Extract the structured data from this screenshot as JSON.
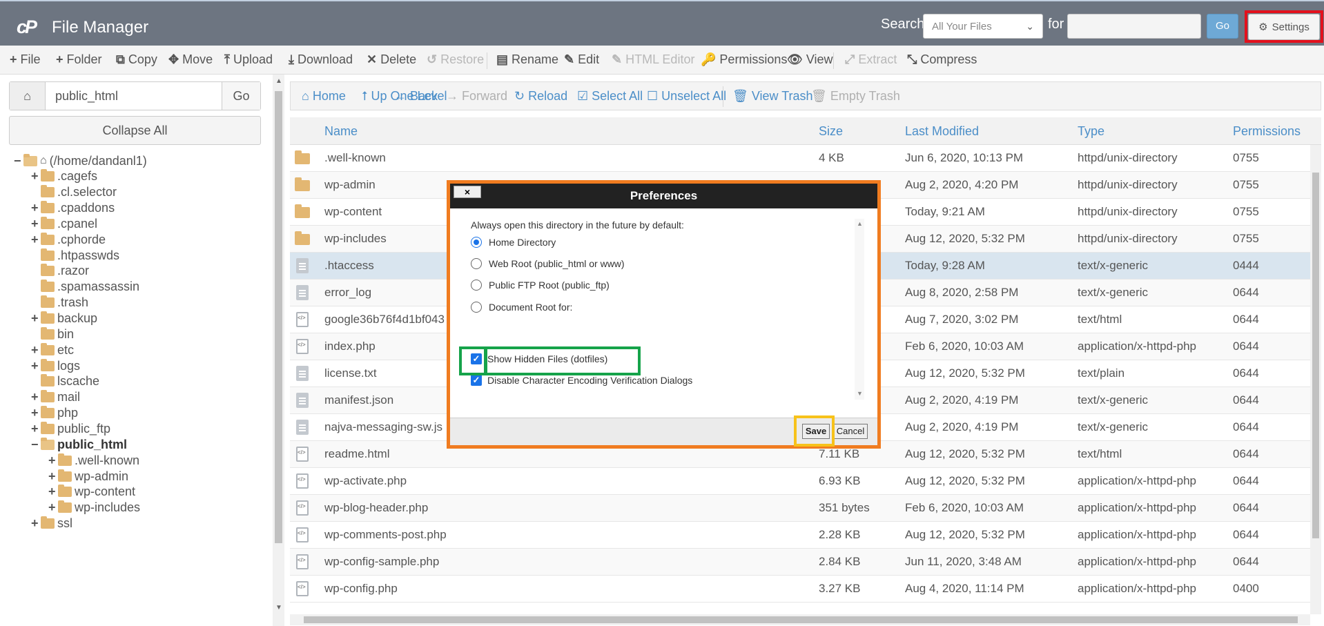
{
  "header": {
    "app_title": "File Manager",
    "logo": "cP",
    "search_label": "Search",
    "search_scope": "All Your Files",
    "for_label": "for",
    "search_value": "",
    "go_label": "Go",
    "settings_label": "Settings"
  },
  "toolbar": {
    "items": [
      "File",
      "Folder",
      "Copy",
      "Move",
      "Upload",
      "Download",
      "Delete",
      "Restore",
      "Rename",
      "Edit",
      "HTML Editor",
      "Permissions",
      "View",
      "Extract",
      "Compress"
    ]
  },
  "sidebar": {
    "path": "public_html",
    "go_label": "Go",
    "collapse_label": "Collapse All",
    "tree": [
      {
        "label": "(/home/dandanl1)",
        "level": 0,
        "pm": "−"
      },
      {
        "label": ".cagefs",
        "level": 1,
        "pm": "+"
      },
      {
        "label": ".cl.selector",
        "level": 1,
        "pm": ""
      },
      {
        "label": ".cpaddons",
        "level": 1,
        "pm": "+"
      },
      {
        "label": ".cpanel",
        "level": 1,
        "pm": "+"
      },
      {
        "label": ".cphorde",
        "level": 1,
        "pm": "+"
      },
      {
        "label": ".htpasswds",
        "level": 1,
        "pm": ""
      },
      {
        "label": ".razor",
        "level": 1,
        "pm": ""
      },
      {
        "label": ".spamassassin",
        "level": 1,
        "pm": ""
      },
      {
        "label": ".trash",
        "level": 1,
        "pm": ""
      },
      {
        "label": "backup",
        "level": 1,
        "pm": "+"
      },
      {
        "label": "bin",
        "level": 1,
        "pm": ""
      },
      {
        "label": "etc",
        "level": 1,
        "pm": "+"
      },
      {
        "label": "logs",
        "level": 1,
        "pm": "+"
      },
      {
        "label": "lscache",
        "level": 1,
        "pm": ""
      },
      {
        "label": "mail",
        "level": 1,
        "pm": "+"
      },
      {
        "label": "php",
        "level": 1,
        "pm": "+"
      },
      {
        "label": "public_ftp",
        "level": 1,
        "pm": "+"
      },
      {
        "label": "public_html",
        "level": 1,
        "pm": "−"
      },
      {
        "label": ".well-known",
        "level": 2,
        "pm": "+"
      },
      {
        "label": "wp-admin",
        "level": 2,
        "pm": "+"
      },
      {
        "label": "wp-content",
        "level": 2,
        "pm": "+"
      },
      {
        "label": "wp-includes",
        "level": 2,
        "pm": "+"
      },
      {
        "label": "ssl",
        "level": 1,
        "pm": "+"
      }
    ]
  },
  "navbar": {
    "items": [
      "Home",
      "Up One Level",
      "Back",
      "Forward",
      "Reload",
      "Select All",
      "Unselect All",
      "View Trash",
      "Empty Trash"
    ]
  },
  "table": {
    "columns": [
      "Name",
      "Size",
      "Last Modified",
      "Type",
      "Permissions"
    ],
    "rows": [
      {
        "icon": "folder",
        "name": ".well-known",
        "size": "4 KB",
        "modified": "Jun 6, 2020, 10:13 PM",
        "type": "httpd/unix-directory",
        "perm": "0755"
      },
      {
        "icon": "folder",
        "name": "wp-admin",
        "size": "",
        "modified": "Aug 2, 2020, 4:20 PM",
        "type": "httpd/unix-directory",
        "perm": "0755"
      },
      {
        "icon": "folder",
        "name": "wp-content",
        "size": "",
        "modified": "Today, 9:21 AM",
        "type": "httpd/unix-directory",
        "perm": "0755"
      },
      {
        "icon": "folder",
        "name": "wp-includes",
        "size": "",
        "modified": "Aug 12, 2020, 5:32 PM",
        "type": "httpd/unix-directory",
        "perm": "0755"
      },
      {
        "icon": "doc",
        "name": ".htaccess",
        "size": "",
        "modified": "Today, 9:28 AM",
        "type": "text/x-generic",
        "perm": "0444"
      },
      {
        "icon": "doc",
        "name": "error_log",
        "size": "",
        "modified": "Aug 8, 2020, 2:58 PM",
        "type": "text/x-generic",
        "perm": "0644"
      },
      {
        "icon": "code",
        "name": "google36b76f4d1bf043",
        "size": "",
        "modified": "Aug 7, 2020, 3:02 PM",
        "type": "text/html",
        "perm": "0644"
      },
      {
        "icon": "code",
        "name": "index.php",
        "size": "",
        "modified": "Feb 6, 2020, 10:03 AM",
        "type": "application/x-httpd-php",
        "perm": "0644"
      },
      {
        "icon": "doc",
        "name": "license.txt",
        "size": "",
        "modified": "Aug 12, 2020, 5:32 PM",
        "type": "text/plain",
        "perm": "0644"
      },
      {
        "icon": "doc",
        "name": "manifest.json",
        "size": "",
        "modified": "Aug 2, 2020, 4:19 PM",
        "type": "text/x-generic",
        "perm": "0644"
      },
      {
        "icon": "doc",
        "name": "najva-messaging-sw.js",
        "size": "",
        "modified": "Aug 2, 2020, 4:19 PM",
        "type": "text/x-generic",
        "perm": "0644"
      },
      {
        "icon": "code",
        "name": "readme.html",
        "size": "7.11 KB",
        "modified": "Aug 12, 2020, 5:32 PM",
        "type": "text/html",
        "perm": "0644"
      },
      {
        "icon": "code",
        "name": "wp-activate.php",
        "size": "6.93 KB",
        "modified": "Aug 12, 2020, 5:32 PM",
        "type": "application/x-httpd-php",
        "perm": "0644"
      },
      {
        "icon": "code",
        "name": "wp-blog-header.php",
        "size": "351 bytes",
        "modified": "Feb 6, 2020, 10:03 AM",
        "type": "application/x-httpd-php",
        "perm": "0644"
      },
      {
        "icon": "code",
        "name": "wp-comments-post.php",
        "size": "2.28 KB",
        "modified": "Aug 12, 2020, 5:32 PM",
        "type": "application/x-httpd-php",
        "perm": "0644"
      },
      {
        "icon": "code",
        "name": "wp-config-sample.php",
        "size": "2.84 KB",
        "modified": "Jun 11, 2020, 3:48 AM",
        "type": "application/x-httpd-php",
        "perm": "0644"
      },
      {
        "icon": "code",
        "name": "wp-config.php",
        "size": "3.27 KB",
        "modified": "Aug 4, 2020, 11:14 PM",
        "type": "application/x-httpd-php",
        "perm": "0400"
      }
    ]
  },
  "dialog": {
    "title": "Preferences",
    "close": "×",
    "prompt": "Always open this directory in the future by default:",
    "radios": [
      "Home Directory",
      "Web Root (public_html or www)",
      "Public FTP Root (public_ftp)",
      "Document Root for:"
    ],
    "selected_radio": "Home Directory",
    "checks": [
      "Show Hidden Files (dotfiles)",
      "Disable Character Encoding Verification Dialogs"
    ],
    "save": "Save",
    "cancel": "Cancel"
  },
  "colors": {
    "header_bg": "#6d7581",
    "link": "#4b8ec8",
    "highlight_red": "#e3101c",
    "highlight_orange": "#f07c20",
    "highlight_green": "#16a34a",
    "highlight_yellow": "#f7c21b"
  }
}
